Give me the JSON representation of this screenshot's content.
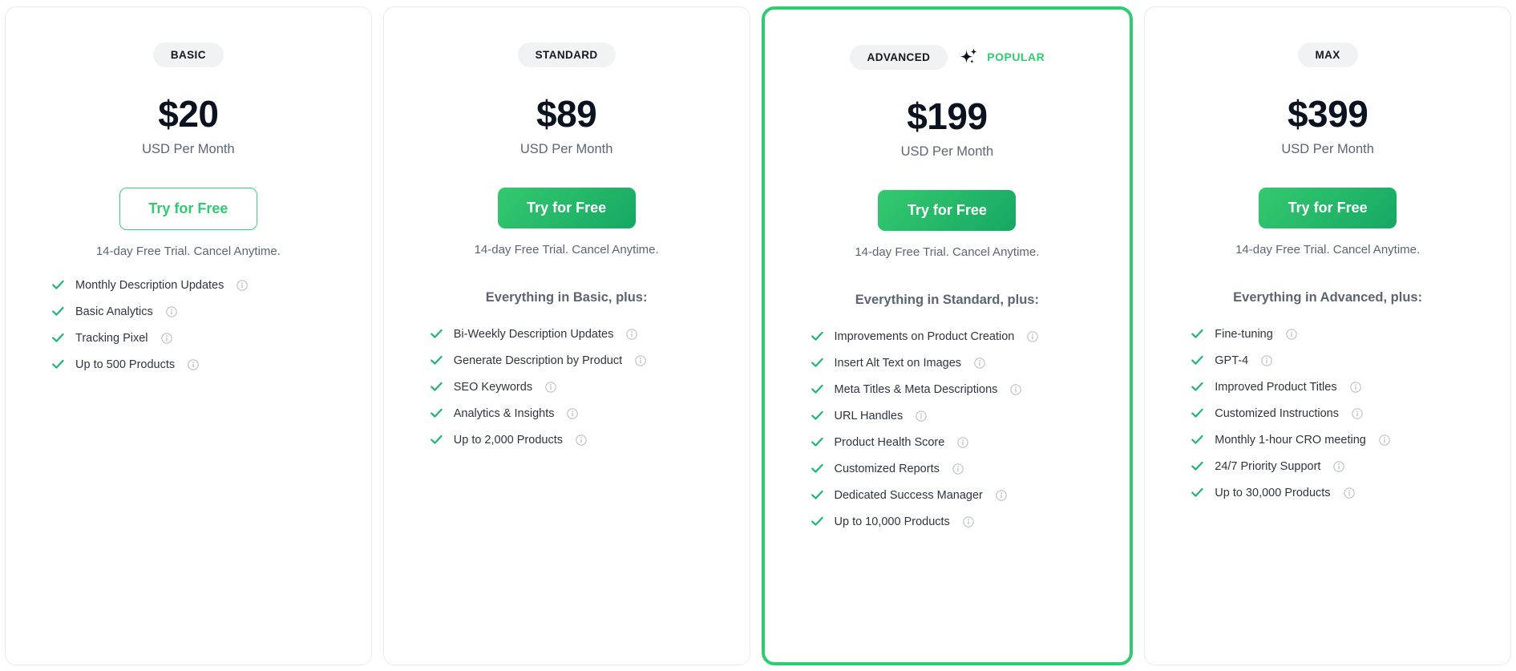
{
  "colors": {
    "accent_green": "#2ecc71",
    "button_gradient_start": "#34c96f",
    "button_gradient_end": "#16a864",
    "badge_background": "#f1f2f4",
    "price_text": "#0c1320",
    "muted_text": "#5c6575",
    "card_border": "#e9eaec",
    "featured_border": "#2ecc71"
  },
  "icons": {
    "check": "check-icon",
    "info": "info-icon",
    "sparkle": "sparkle-icon"
  },
  "plans": [
    {
      "tier": "BASIC",
      "price": "$20",
      "period": "USD Per Month",
      "cta_label": "Try for Free",
      "cta_style": "outline",
      "trial_note": "14-day Free Trial. Cancel Anytime.",
      "everything_line": "",
      "featured": false,
      "popular_label": "",
      "features": [
        "Monthly Description Updates",
        "Basic Analytics",
        "Tracking Pixel",
        "Up to 500 Products"
      ]
    },
    {
      "tier": "STANDARD",
      "price": "$89",
      "period": "USD Per Month",
      "cta_label": "Try for Free",
      "cta_style": "solid",
      "trial_note": "14-day Free Trial. Cancel Anytime.",
      "everything_line": "Everything in Basic, plus:",
      "featured": false,
      "popular_label": "",
      "features": [
        "Bi-Weekly Description Updates",
        "Generate Description by Product",
        "SEO Keywords",
        "Analytics & Insights",
        "Up to 2,000 Products"
      ]
    },
    {
      "tier": "ADVANCED",
      "price": "$199",
      "period": "USD Per Month",
      "cta_label": "Try for Free",
      "cta_style": "solid",
      "trial_note": "14-day Free Trial. Cancel Anytime.",
      "everything_line": "Everything in Standard, plus:",
      "featured": true,
      "popular_label": "POPULAR",
      "features": [
        "Improvements on Product Creation",
        "Insert Alt Text on Images",
        "Meta Titles & Meta Descriptions",
        "URL Handles",
        "Product Health Score",
        "Customized Reports",
        "Dedicated Success Manager",
        "Up to 10,000 Products"
      ]
    },
    {
      "tier": "MAX",
      "price": "$399",
      "period": "USD Per Month",
      "cta_label": "Try for Free",
      "cta_style": "solid",
      "trial_note": "14-day Free Trial. Cancel Anytime.",
      "everything_line": "Everything in Advanced, plus:",
      "featured": false,
      "popular_label": "",
      "features": [
        "Fine-tuning",
        "GPT-4",
        "Improved Product Titles",
        "Customized Instructions",
        "Monthly 1-hour CRO meeting",
        "24/7 Priority Support",
        "Up to 30,000 Products"
      ]
    }
  ]
}
